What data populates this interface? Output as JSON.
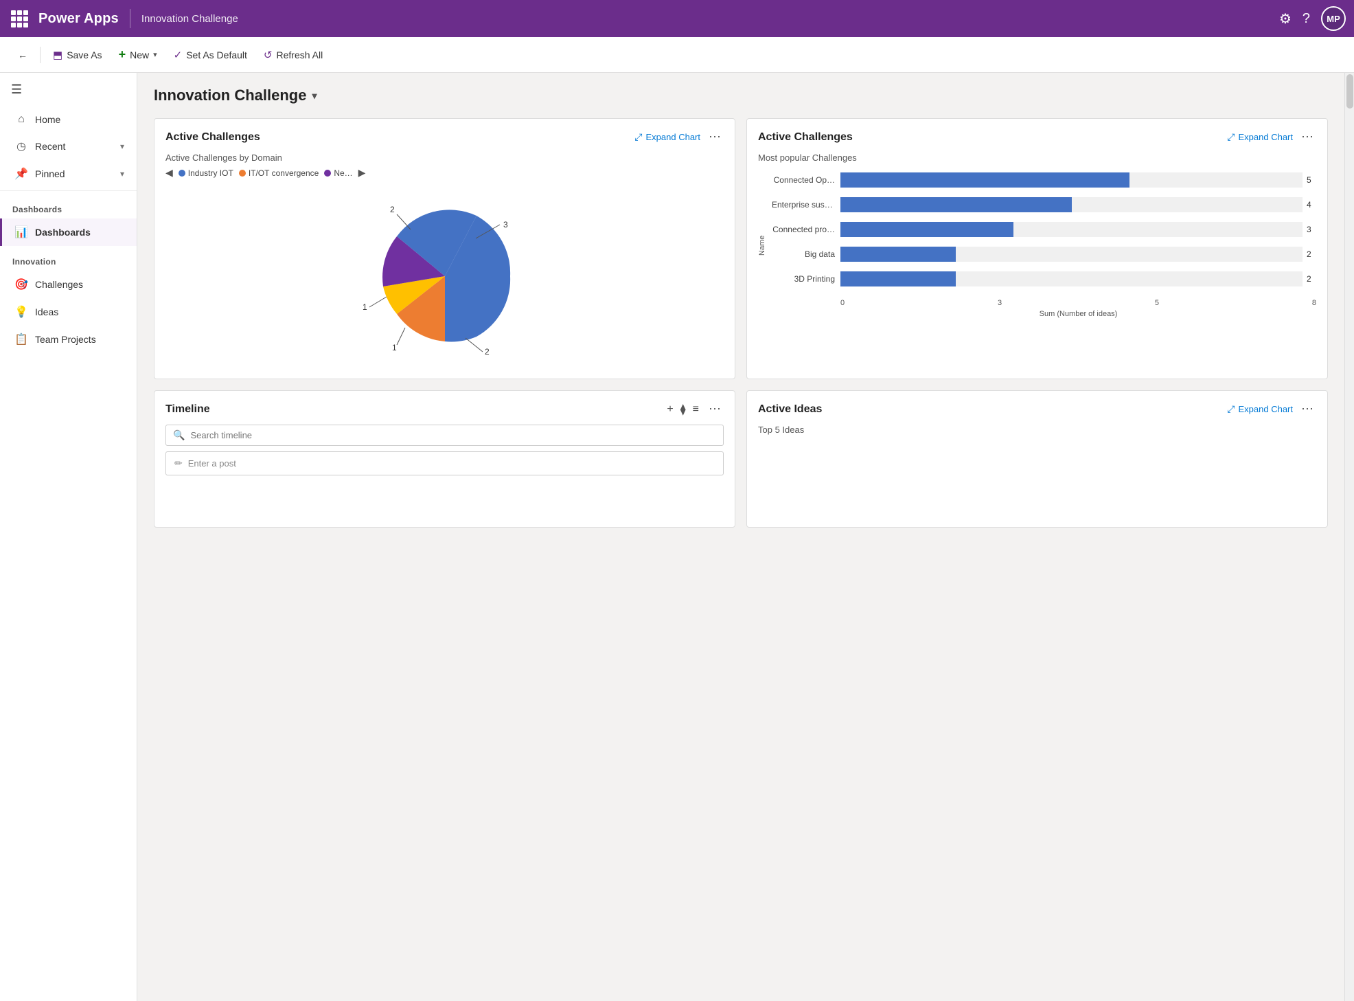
{
  "topNav": {
    "appName": "Power Apps",
    "pageTitle": "Innovation Challenge",
    "avatarInitials": "MP"
  },
  "toolbar": {
    "saveAsLabel": "Save As",
    "newLabel": "New",
    "setDefaultLabel": "Set As Default",
    "refreshAllLabel": "Refresh All"
  },
  "sidebar": {
    "hamburgerIcon": "☰",
    "items": [
      {
        "id": "home",
        "label": "Home",
        "icon": "⌂"
      },
      {
        "id": "recent",
        "label": "Recent",
        "icon": "◷",
        "hasChevron": true
      },
      {
        "id": "pinned",
        "label": "Pinned",
        "icon": "📌",
        "hasChevron": true
      }
    ],
    "sections": [
      {
        "label": "Dashboards",
        "items": [
          {
            "id": "dashboards",
            "label": "Dashboards",
            "icon": "📊",
            "active": true
          }
        ]
      },
      {
        "label": "Innovation",
        "items": [
          {
            "id": "challenges",
            "label": "Challenges",
            "icon": "🎯"
          },
          {
            "id": "ideas",
            "label": "Ideas",
            "icon": "💡"
          },
          {
            "id": "team-projects",
            "label": "Team Projects",
            "icon": "📋"
          }
        ]
      }
    ]
  },
  "mainContent": {
    "pageTitle": "Innovation Challenge",
    "cards": [
      {
        "id": "active-challenges-pie",
        "title": "Active Challenges",
        "expandLabel": "Expand Chart",
        "subtitle": "Active Challenges by Domain",
        "chartType": "pie",
        "legend": [
          {
            "label": "Industry IOT",
            "color": "#4472c4"
          },
          {
            "label": "IT/OT convergence",
            "color": "#ed7d31"
          },
          {
            "label": "Ne…",
            "color": "#7030a0"
          }
        ],
        "pieData": [
          {
            "label": "3",
            "value": 3,
            "color": "#4472c4",
            "startAngle": -30,
            "endAngle": 130
          },
          {
            "label": "2",
            "value": 2,
            "color": "#ed7d31",
            "startAngle": 130,
            "endAngle": 220
          },
          {
            "label": "1",
            "value": 1,
            "color": "#ffc000",
            "startAngle": 220,
            "endAngle": 265
          },
          {
            "label": "1",
            "value": 1,
            "color": "#7030a0",
            "startAngle": 265,
            "endAngle": 310
          },
          {
            "label": "2",
            "value": 2,
            "color": "#c00000",
            "startAngle": 310,
            "endAngle": 330
          }
        ]
      },
      {
        "id": "active-challenges-bar",
        "title": "Active Challenges",
        "expandLabel": "Expand Chart",
        "subtitle": "Most popular Challenges",
        "chartType": "bar",
        "yAxisLabel": "Name",
        "xAxisLabel": "Sum (Number of ideas)",
        "xAxisTicks": [
          "0",
          "3",
          "5",
          "8"
        ],
        "maxValue": 8,
        "bars": [
          {
            "label": "Connected Op…",
            "value": 5
          },
          {
            "label": "Enterprise sust…",
            "value": 4
          },
          {
            "label": "Connected pro…",
            "value": 3
          },
          {
            "label": "Big data",
            "value": 2
          },
          {
            "label": "3D Printing",
            "value": 2
          }
        ],
        "barColor": "#4472c4"
      },
      {
        "id": "timeline",
        "title": "Timeline",
        "searchPlaceholder": "Search timeline",
        "enterPostPlaceholder": "Enter a post"
      },
      {
        "id": "active-ideas",
        "title": "Active Ideas",
        "expandLabel": "Expand Chart",
        "subtitle": "Top 5 Ideas"
      }
    ]
  }
}
